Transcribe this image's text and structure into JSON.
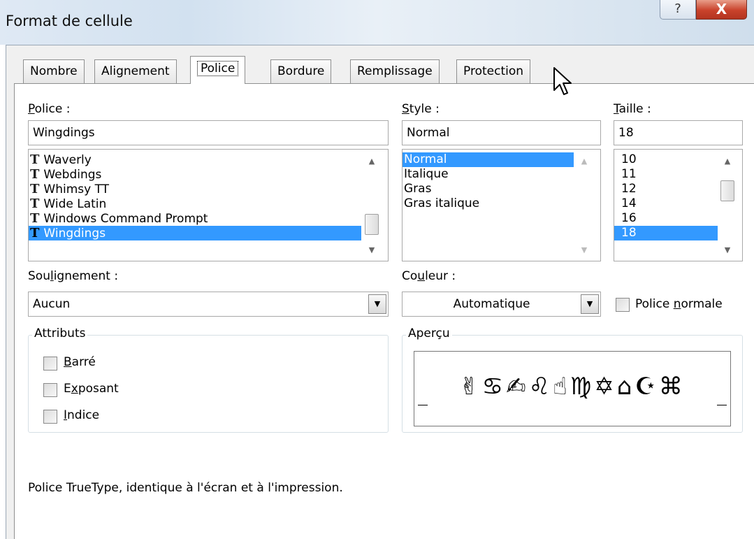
{
  "window": {
    "title": "Format de cellule",
    "help_label": "?",
    "close_label": "X"
  },
  "tabs": [
    {
      "label": "Nombre"
    },
    {
      "label": "Alignement"
    },
    {
      "label": "Police"
    },
    {
      "label": "Bordure"
    },
    {
      "label": "Remplissage"
    },
    {
      "label": "Protection"
    }
  ],
  "font": {
    "label_u": "P",
    "label_rest": "olice :",
    "value": "Wingdings",
    "items": [
      "Waverly",
      "Webdings",
      "Whimsy TT",
      "Wide Latin",
      "Windows Command Prompt",
      "Wingdings"
    ],
    "tt_glyph": "T"
  },
  "style": {
    "label_u": "S",
    "label_rest": "tyle :",
    "value": "Normal",
    "items": [
      "Normal",
      "Italique",
      "Gras",
      "Gras italique"
    ]
  },
  "size": {
    "label_u": "T",
    "label_rest": "aille :",
    "value": "18",
    "items": [
      "10",
      "11",
      "12",
      "14",
      "16",
      "18"
    ]
  },
  "underline": {
    "label_a": "Sou",
    "label_u": "l",
    "label_b": "ignement :",
    "value": "Aucun"
  },
  "color": {
    "label_a": "Co",
    "label_u": "u",
    "label_b": "leur :",
    "value": "Automatique"
  },
  "normal_font": {
    "label_a": "Police ",
    "label_u": "n",
    "label_b": "ormale"
  },
  "attributes": {
    "title": "Attributs",
    "strike": {
      "u": "B",
      "rest": "arré"
    },
    "superscript": {
      "a": "E",
      "u": "x",
      "b": "posant"
    },
    "subscript": {
      "u": "I",
      "rest": "ndice"
    }
  },
  "preview": {
    "title": "Aperçu",
    "sample": "✌♋✍♌☝♍✡⌂☪⌘"
  },
  "description": "Police TrueType, identique à l'écran et à l'impression.",
  "scroll_arrows": {
    "up": "▲",
    "down": "▼"
  }
}
